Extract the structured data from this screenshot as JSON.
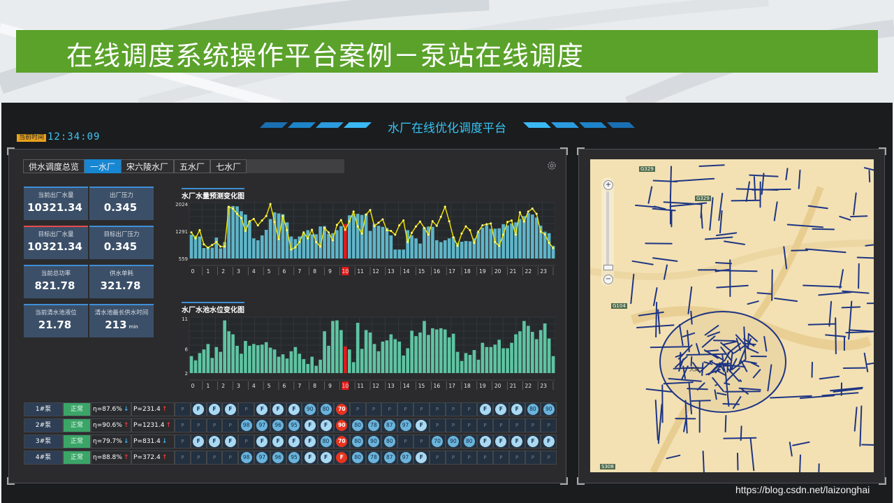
{
  "slide_title": "在线调度系统操作平台案例－泵站在线调度",
  "platform_title": "水厂在线优化调度平台",
  "clock": {
    "label": "当前时间",
    "value": "12:34:09"
  },
  "tabs": [
    "供水调度总览",
    "一水厂",
    "宋六陵水厂",
    "五水厂",
    "七水厂"
  ],
  "active_tab": "一水厂",
  "kpis": [
    {
      "label": "当前出厂水量",
      "value": "10321.34",
      "unit": "",
      "accent": "#3f8fd6"
    },
    {
      "label": "出厂压力",
      "value": "0.345",
      "unit": "",
      "accent": "#3f8fd6"
    },
    {
      "label": "目标出厂水量",
      "value": "10321.34",
      "unit": "",
      "accent": "#e94b4b"
    },
    {
      "label": "目标出厂压力",
      "value": "0.345",
      "unit": "",
      "accent": "#3f8fd6"
    },
    {
      "label": "当前总功率",
      "value": "821.78",
      "unit": "",
      "accent": "#3f8fd6"
    },
    {
      "label": "供水单耗",
      "value": "321.78",
      "unit": "",
      "accent": "#3f8fd6"
    },
    {
      "label": "当前清水池液位",
      "value": "21.78",
      "unit": "",
      "accent": "#3f8fd6"
    },
    {
      "label": "清水池最长供水时间",
      "value": "213",
      "unit": "min",
      "accent": "#3f8fd6"
    }
  ],
  "chart_data": [
    {
      "type": "bar",
      "title": "水厂水量预测变化图",
      "yticks": [
        559,
        1291,
        2024
      ],
      "ylim": [
        559,
        2024
      ],
      "xticks": [
        "0",
        "1",
        "2",
        "3",
        "4",
        "5",
        "6",
        "7",
        "8",
        "9",
        "10",
        "11",
        "12",
        "13",
        "14",
        "15",
        "16",
        "17",
        "18",
        "19",
        "20",
        "21",
        "22",
        "23"
      ],
      "highlight_hour": "10",
      "bar_color": "#5fb5c9",
      "highlight_color": "#e51b1b",
      "line_color": "#f5e800",
      "bars": [
        1200,
        1170,
        1150,
        840,
        860,
        850,
        1120,
        830,
        1000,
        1950,
        1970,
        1960,
        1830,
        1740,
        1560,
        1100,
        1050,
        1180,
        1330,
        1620,
        1800,
        1770,
        1750,
        1530,
        1150,
        1080,
        1150,
        1240,
        1320,
        1210,
        1210,
        1420,
        1430,
        1220,
        1240,
        1320,
        1430,
        1480,
        1720,
        1760,
        1760,
        1730,
        1760,
        1300,
        1490,
        1440,
        1410,
        1380,
        1180,
        800,
        800,
        800,
        1320,
        1180,
        1100,
        960,
        1390,
        1420,
        1410,
        1050,
        1000,
        1050,
        1100,
        1140,
        980,
        1010,
        1030,
        1020,
        1100,
        1270,
        1390,
        1450,
        1360,
        1360,
        1370,
        1480,
        1450,
        1500,
        1530,
        1620,
        1700,
        1780,
        1740,
        1660,
        1440,
        1280,
        1240,
        900
      ],
      "line": [
        1260,
        1100,
        1320,
        940,
        850,
        920,
        1000,
        880,
        880,
        1950,
        1900,
        1760,
        1650,
        1300,
        1560,
        1620,
        1450,
        1580,
        1700,
        2020,
        1540,
        1080,
        1700,
        1320,
        800,
        860,
        1000,
        1260,
        1100,
        1330,
        1000,
        880,
        1380,
        1260,
        1050,
        1460,
        1590,
        1330,
        1560,
        1820,
        1420,
        1230,
        1740,
        1860,
        1430,
        1520,
        1610,
        1320,
        1300,
        1200,
        1450,
        1580,
        1000,
        1250,
        1420,
        1550,
        1380,
        1200,
        1560,
        1440,
        1680,
        1950,
        1560,
        1130,
        900,
        1230,
        1420,
        1320,
        980,
        1280,
        1450,
        1480,
        1500,
        1000,
        900,
        1200,
        1540,
        1580,
        1200,
        1800,
        1550,
        1820,
        1900,
        1760,
        1280,
        1210,
        980,
        840
      ]
    },
    {
      "type": "bar",
      "title": "水厂水池水位变化图",
      "yticks": [
        2,
        6,
        11
      ],
      "ylim": [
        2,
        11
      ],
      "xticks": [
        "0",
        "1",
        "2",
        "3",
        "4",
        "5",
        "6",
        "7",
        "8",
        "9",
        "10",
        "11",
        "12",
        "13",
        "14",
        "15",
        "16",
        "17",
        "18",
        "19",
        "20",
        "21",
        "22",
        "23"
      ],
      "highlight_hour": "10",
      "bar_color": "#5fc4a2",
      "highlight_color": "#e51b1b",
      "bars": [
        4.8,
        4.1,
        5.3,
        5.9,
        6.8,
        4.5,
        6.3,
        5.5,
        10.7,
        8.9,
        8.4,
        6.5,
        5.2,
        7.3,
        6.5,
        6.8,
        6.6,
        6.7,
        7.1,
        6.2,
        5.9,
        4.7,
        5.1,
        4.4,
        5.6,
        6.3,
        5.2,
        4.3,
        3.5,
        4.7,
        3.2,
        4.2,
        8.9,
        6.5,
        10.6,
        10.7,
        9.1,
        6.4,
        5.9,
        3.8,
        10.3,
        6.0,
        9.1,
        8.7,
        6.8,
        5.6,
        7.2,
        7.4,
        8.4,
        7.6,
        7.2,
        4.9,
        6.1,
        9.0,
        8.1,
        8.7,
        10.6,
        8.3,
        9.4,
        9.2,
        9.4,
        9.2,
        7.9,
        8.5,
        5.5,
        4.0,
        5.3,
        5.0,
        5.8,
        4.2,
        7.0,
        6.3,
        6.3,
        6.7,
        7.5,
        6.1,
        6.1,
        7.0,
        8.4,
        8.9,
        10.6,
        9.8,
        8.8,
        7.6,
        9.1,
        10.2,
        7.7,
        4.8
      ]
    }
  ],
  "pumps": [
    {
      "name": "1#泵",
      "status": "正常",
      "eff": "η=87.6%",
      "eff_dir": "down",
      "power": "P=231.4",
      "pow_dir": "up",
      "hours": [
        "P",
        "F",
        "F",
        "F",
        "P",
        "F",
        "F",
        "F",
        "90",
        "80",
        "70",
        "P",
        "P",
        "P",
        "P",
        "P",
        "P",
        "P",
        "P",
        "F",
        "F",
        "F",
        "80",
        "90"
      ]
    },
    {
      "name": "2#泵",
      "status": "正常",
      "eff": "η=90.6%",
      "eff_dir": "up",
      "power": "P=1231.4",
      "pow_dir": "up",
      "hours": [
        "P",
        "P",
        "P",
        "P",
        "98",
        "97",
        "96",
        "95",
        "F",
        "F",
        "90",
        "80",
        "78",
        "87",
        "97",
        "F",
        "P",
        "P",
        "P",
        "P",
        "P",
        "P",
        "P",
        "P"
      ]
    },
    {
      "name": "3#泵",
      "status": "正常",
      "eff": "η=79.7%",
      "eff_dir": "down",
      "power": "P=831.4",
      "pow_dir": "down",
      "hours": [
        "P",
        "F",
        "F",
        "F",
        "P",
        "F",
        "F",
        "F",
        "F",
        "80",
        "70",
        "80",
        "90",
        "80",
        "P",
        "P",
        "70",
        "90",
        "80",
        "F",
        "F",
        "F",
        "F",
        "F"
      ]
    },
    {
      "name": "4#泵",
      "status": "正常",
      "eff": "η=88.8%",
      "eff_dir": "up",
      "power": "P=372.4",
      "pow_dir": "up",
      "hours": [
        "P",
        "P",
        "P",
        "P",
        "98",
        "97",
        "96",
        "95",
        "F",
        "F",
        "F",
        "80",
        "78",
        "87",
        "97",
        "F",
        "P",
        "P",
        "P",
        "P",
        "P",
        "P",
        "P",
        "P"
      ]
    }
  ],
  "map_labels": [
    "G329",
    "G329",
    "G104",
    "S308",
    "大禹"
  ],
  "watermark": "https://blog.csdn.net/laizonghai"
}
